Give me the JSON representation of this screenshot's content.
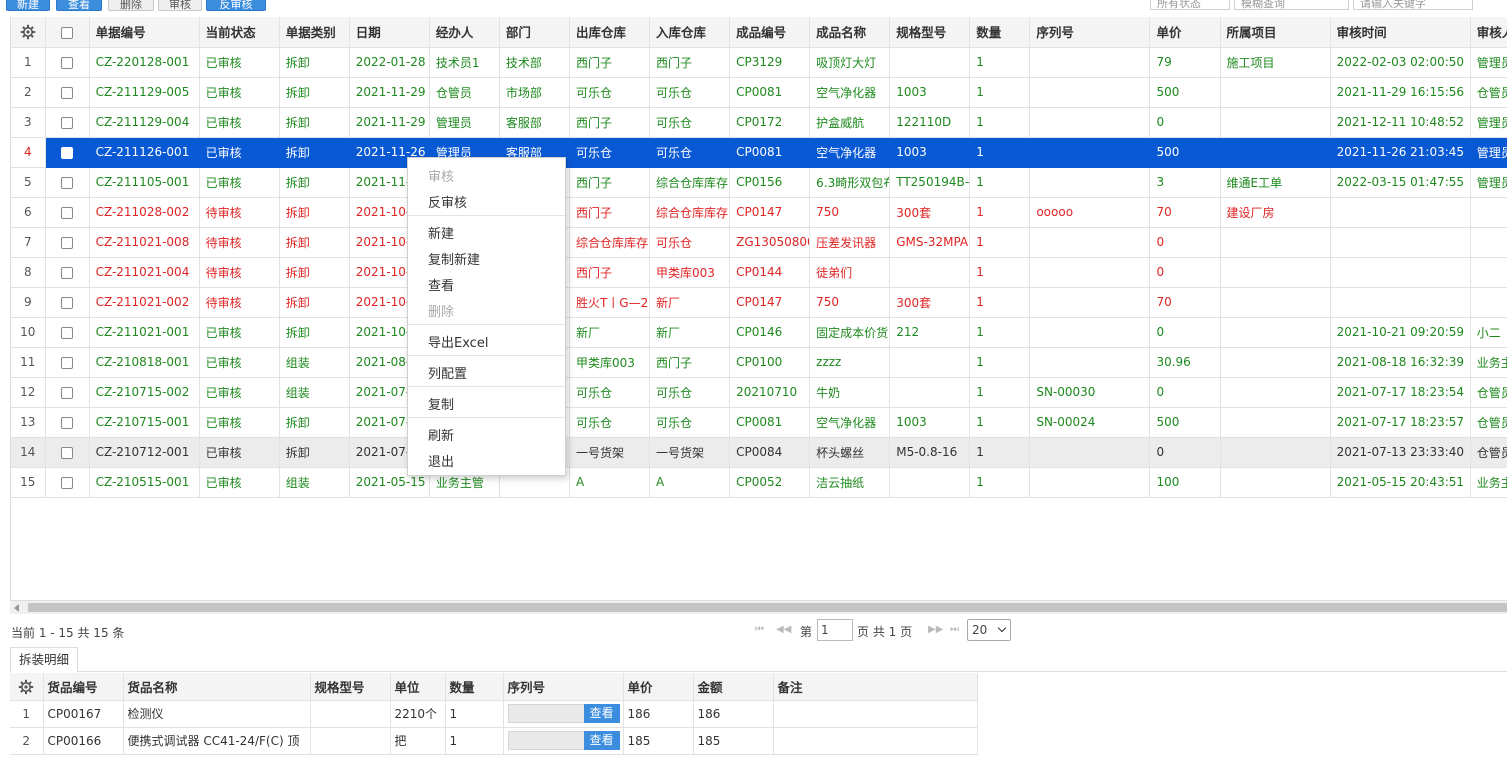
{
  "toolbar": {
    "buttons": [
      "新建",
      "查看",
      "删除",
      "审核",
      "反审核"
    ],
    "status_filter": "所有状态",
    "query_mode": "模糊查询",
    "search_placeholder": "请输入关键字"
  },
  "grid": {
    "columns": [
      "单据编号",
      "当前状态",
      "单据类别",
      "日期",
      "经办人",
      "部门",
      "出库仓库",
      "入库仓库",
      "成品编号",
      "成品名称",
      "规格型号",
      "数量",
      "序列号",
      "单价",
      "所属项目",
      "审核时间",
      "审核人"
    ],
    "rows": [
      {
        "n": "1",
        "status": "green",
        "c": [
          "CZ-220128-001",
          "已审核",
          "拆卸",
          "2022-01-28",
          "技术员1",
          "技术部",
          "西门子",
          "西门子",
          "CP3129",
          "吸顶灯大灯",
          "",
          "1",
          "",
          "79",
          "施工项目",
          "2022-02-03 02:00:50",
          "管理员"
        ]
      },
      {
        "n": "2",
        "status": "green",
        "c": [
          "CZ-211129-005",
          "已审核",
          "拆卸",
          "2021-11-29",
          "仓管员",
          "市场部",
          "可乐仓",
          "可乐仓",
          "CP0081",
          "空气净化器",
          "1003",
          "1",
          "",
          "500",
          "",
          "2021-11-29 16:15:56",
          "仓管员"
        ]
      },
      {
        "n": "3",
        "status": "green",
        "c": [
          "CZ-211129-004",
          "已审核",
          "拆卸",
          "2021-11-29",
          "管理员",
          "客服部",
          "西门子",
          "可乐仓",
          "CP0172",
          "护盒威航",
          "122110D",
          "1",
          "",
          "0",
          "",
          "2021-12-11 10:48:52",
          "管理员"
        ]
      },
      {
        "n": "4",
        "status": "sel",
        "c": [
          "CZ-211126-001",
          "已审核",
          "拆卸",
          "2021-11-26",
          "管理员",
          "客服部",
          "可乐仓",
          "可乐仓",
          "CP0081",
          "空气净化器",
          "1003",
          "1",
          "",
          "500",
          "",
          "2021-11-26 21:03:45",
          "管理员"
        ]
      },
      {
        "n": "5",
        "status": "green",
        "c": [
          "CZ-211105-001",
          "已审核",
          "拆卸",
          "2021-11-05",
          "",
          "",
          "西门子",
          "综合仓库库存",
          "CP0156",
          "6.3畸形双包布",
          "TT250194B—",
          "1",
          "",
          "3",
          "维通E工单",
          "2022-03-15 01:47:55",
          "管理员"
        ]
      },
      {
        "n": "6",
        "status": "red",
        "c": [
          "CZ-211028-002",
          "待审核",
          "拆卸",
          "2021-10-28",
          "",
          "",
          "西门子",
          "综合仓库库存",
          "CP0147",
          "750",
          "300套",
          "1",
          "ooooo",
          "70",
          "建设厂房",
          "",
          ""
        ]
      },
      {
        "n": "7",
        "status": "red",
        "c": [
          "CZ-211021-008",
          "待审核",
          "拆卸",
          "2021-10-21",
          "",
          "",
          "综合仓库库存",
          "可乐仓",
          "ZG13050800",
          "压差发讯器",
          "GMS-32MPA",
          "1",
          "",
          "0",
          "",
          "",
          ""
        ]
      },
      {
        "n": "8",
        "status": "red",
        "c": [
          "CZ-211021-004",
          "待审核",
          "拆卸",
          "2021-10-21",
          "",
          "",
          "西门子",
          "甲类库003",
          "CP0144",
          "徒弟们",
          "",
          "1",
          "",
          "0",
          "",
          "",
          ""
        ]
      },
      {
        "n": "9",
        "status": "red",
        "c": [
          "CZ-211021-002",
          "待审核",
          "拆卸",
          "2021-10-21",
          "",
          "",
          "胜火T丨G—2",
          "新厂",
          "CP0147",
          "750",
          "300套",
          "1",
          "",
          "70",
          "",
          "",
          ""
        ]
      },
      {
        "n": "10",
        "status": "green",
        "c": [
          "CZ-211021-001",
          "已审核",
          "拆卸",
          "2021-10-21",
          "",
          "",
          "新厂",
          "新厂",
          "CP0146",
          "固定成本价货",
          "212",
          "1",
          "",
          "0",
          "",
          "2021-10-21 09:20:59",
          "小二"
        ]
      },
      {
        "n": "11",
        "status": "green",
        "c": [
          "CZ-210818-001",
          "已审核",
          "组装",
          "2021-08-18",
          "",
          "",
          "甲类库003",
          "西门子",
          "CP0100",
          "zzzz",
          "",
          "1",
          "",
          "30.96",
          "",
          "2021-08-18 16:32:39",
          "业务主管"
        ]
      },
      {
        "n": "12",
        "status": "green",
        "c": [
          "CZ-210715-002",
          "已审核",
          "组装",
          "2021-07-15",
          "",
          "",
          "可乐仓",
          "可乐仓",
          "20210710",
          "牛奶",
          "",
          "1",
          "SN-00030",
          "0",
          "",
          "2021-07-17 18:23:54",
          "仓管员"
        ]
      },
      {
        "n": "13",
        "status": "green",
        "c": [
          "CZ-210715-001",
          "已审核",
          "拆卸",
          "2021-07-15",
          "",
          "",
          "可乐仓",
          "可乐仓",
          "CP0081",
          "空气净化器",
          "1003",
          "1",
          "SN-00024",
          "500",
          "",
          "2021-07-17 18:23:57",
          "仓管员"
        ]
      },
      {
        "n": "14",
        "status": "hover",
        "c": [
          "CZ-210712-001",
          "已审核",
          "拆卸",
          "2021-07-12",
          "",
          "",
          "一号货架",
          "一号货架",
          "CP0084",
          "杯头螺丝",
          "M5-0.8-16",
          "1",
          "",
          "0",
          "",
          "2021-07-13 23:33:40",
          "仓管员"
        ]
      },
      {
        "n": "15",
        "status": "green",
        "c": [
          "CZ-210515-001",
          "已审核",
          "组装",
          "2021-05-15",
          "业务主管",
          "",
          "A",
          "A",
          "CP0052",
          "洁云抽纸",
          "",
          "1",
          "",
          "100",
          "",
          "2021-05-15 20:43:51",
          "业务主管"
        ]
      }
    ]
  },
  "pager": {
    "info": "当前 1 - 15 共 15 条",
    "page_prefix": "第",
    "page_value": "1",
    "page_suffix": "页 共 1 页",
    "page_size": "20"
  },
  "detail": {
    "tab": "拆装明细",
    "columns": [
      "货品编号",
      "货品名称",
      "规格型号",
      "单位",
      "数量",
      "序列号",
      "单价",
      "金额",
      "备注"
    ],
    "view_label": "查看",
    "rows": [
      {
        "n": "1",
        "c": [
          "CP00167",
          "检测仪",
          "",
          "2210个",
          "1",
          "",
          "186",
          "186",
          ""
        ]
      },
      {
        "n": "2",
        "c": [
          "CP00166",
          "便携式调试器 CC41-24/F(C) 顶",
          "",
          "把",
          "1",
          "",
          "185",
          "185",
          ""
        ]
      }
    ]
  },
  "context_menu": {
    "audit": "审核",
    "unaudit": "反审核",
    "new": "新建",
    "copy_new": "复制新建",
    "view": "查看",
    "delete": "删除",
    "export_excel": "导出Excel",
    "column_config": "列配置",
    "copy": "复制",
    "refresh": "刷新",
    "exit": "退出"
  },
  "colors": {
    "approved": "#1e8a1e",
    "pending": "#e02424",
    "selected": "#0a59d4",
    "primary_button": "#3c8dde"
  }
}
